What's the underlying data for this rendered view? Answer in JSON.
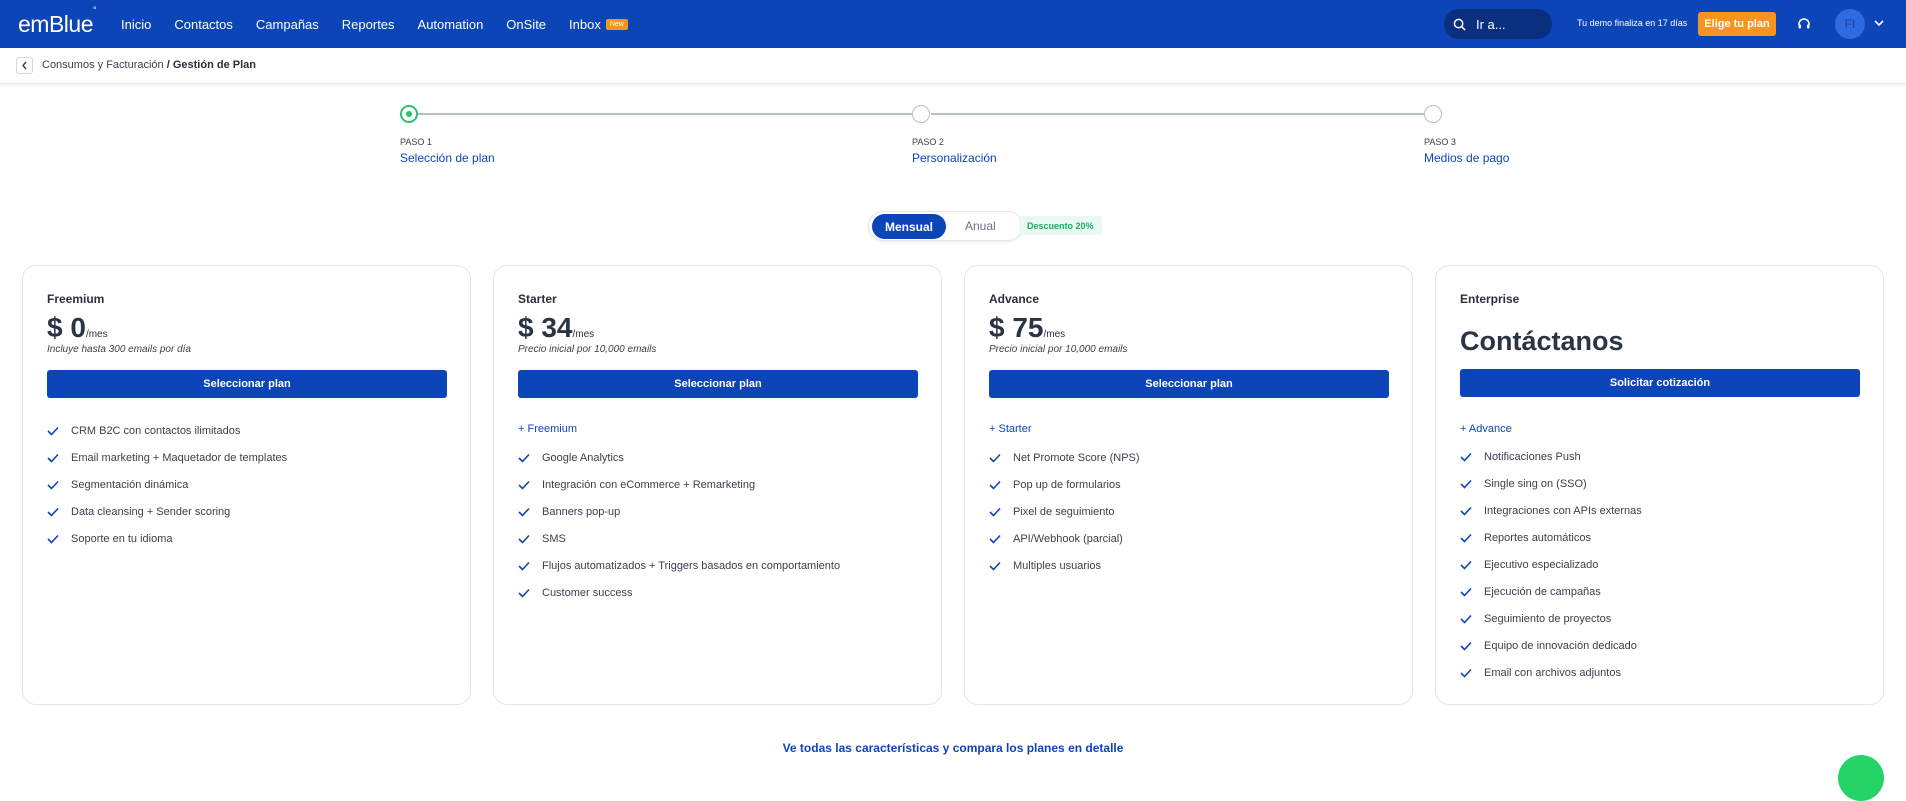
{
  "header": {
    "logo": "emBlue",
    "logo_mark": "°",
    "nav": [
      "Inicio",
      "Contactos",
      "Campañas",
      "Reportes",
      "Automation",
      "OnSite"
    ],
    "inbox_label": "Inbox",
    "inbox_badge": "New",
    "search_placeholder": "Ir a...",
    "demo_notice": "Tu demo finaliza en 17 días",
    "cta": "Elige tu plan",
    "avatar_initials": "FI"
  },
  "breadcrumb": {
    "parent": "Consumos y Facturación",
    "separator": " / ",
    "current": "Gestión de Plan"
  },
  "steps": [
    {
      "label": "PASO 1",
      "name": "Selección de plan",
      "active": true
    },
    {
      "label": "PASO 2",
      "name": "Personalización",
      "active": false
    },
    {
      "label": "PASO 3",
      "name": "Medios de pago",
      "active": false
    }
  ],
  "billing_toggle": {
    "monthly": "Mensual",
    "annual": "Anual",
    "discount": "Descuento 20%",
    "selected": "Mensual"
  },
  "plans": [
    {
      "name": "Freemium",
      "price": "$ 0",
      "period": "/mes",
      "note": "Incluye hasta 300 emails por día",
      "button": "Seleccionar plan",
      "includes": "",
      "features": [
        "CRM B2C con contactos ilimitados",
        "Email marketing + Maquetador de templates",
        "Segmentación dinámica",
        "Data cleansing + Sender scoring",
        "Soporte en tu idioma"
      ]
    },
    {
      "name": "Starter",
      "price": "$ 34",
      "period": "/mes",
      "note": "Precio inicial por 10,000 emails",
      "button": "Seleccionar plan",
      "includes": "+ Freemium",
      "features": [
        "Google Analytics",
        "Integración con eCommerce + Remarketing",
        "Banners pop-up",
        "SMS",
        "Flujos automatizados + Triggers basados en comportamiento",
        "Customer success"
      ]
    },
    {
      "name": "Advance",
      "price": "$ 75",
      "period": "/mes",
      "note": "Precio inicial por 10,000 emails",
      "button": "Seleccionar plan",
      "includes": "+ Starter",
      "features": [
        "Net Promote Score (NPS)",
        "Pop up de formularios",
        "Pixel de seguimiento",
        "API/Webhook (parcial)",
        "Multiples usuarios"
      ]
    },
    {
      "name": "Enterprise",
      "contact": "Contáctanos",
      "button": "Solicitar cotización",
      "includes": "+ Advance",
      "features": [
        "Notificaciones Push",
        "Single sing on (SSO)",
        "Integraciones con APIs externas",
        "Reportes automáticos",
        "Ejecutivo especializado",
        "Ejecución de campañas",
        "Seguimiento de proyectos",
        "Equipo de innovación dedicado",
        "Email con archivos adjuntos"
      ]
    }
  ],
  "compare_link": "Ve todas las características y compara los planes en detalle",
  "colors": {
    "primary": "#0c45b7",
    "accent": "#f7931e",
    "success": "#2fbf71",
    "whatsapp": "#25d366"
  },
  "icons": [
    "search-icon",
    "headset-icon",
    "chevron-down-icon",
    "chevron-left-icon",
    "check-icon",
    "whatsapp-icon"
  ]
}
